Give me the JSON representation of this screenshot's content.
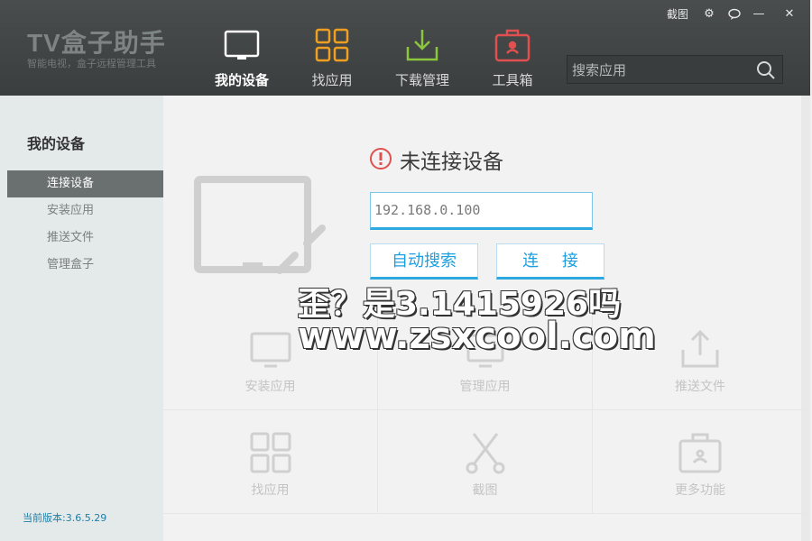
{
  "app": {
    "title": "TV盒子助手",
    "subtitle": "智能电视，盒子远程管理工具"
  },
  "window_controls": {
    "capture": "截图",
    "gear": "⚙",
    "chat": "💬",
    "minimize": "—",
    "close": "✕"
  },
  "nav": {
    "items": [
      {
        "label": "我的设备",
        "icon": "tv-icon",
        "active": true
      },
      {
        "label": "找应用",
        "icon": "apps-grid-icon",
        "active": false
      },
      {
        "label": "下载管理",
        "icon": "download-icon",
        "active": false
      },
      {
        "label": "工具箱",
        "icon": "toolbox-icon",
        "active": false
      }
    ]
  },
  "search": {
    "placeholder": "搜索应用"
  },
  "sidebar": {
    "title": "我的设备",
    "items": [
      {
        "label": "连接设备",
        "active": true
      },
      {
        "label": "安装应用",
        "active": false
      },
      {
        "label": "推送文件",
        "active": false
      },
      {
        "label": "管理盒子",
        "active": false
      }
    ],
    "version": "当前版本:3.6.5.29"
  },
  "connect": {
    "status": "未连接设备",
    "ip_value": "192.168.0.100",
    "auto_search_label": "自动搜索",
    "connect_label": "连 接"
  },
  "features": [
    {
      "label": "安装应用",
      "icon": "tv-icon"
    },
    {
      "label": "管理应用",
      "icon": "manage-icon"
    },
    {
      "label": "推送文件",
      "icon": "push-file-icon"
    },
    {
      "label": "找应用",
      "icon": "apps-grid-icon"
    },
    {
      "label": "截图",
      "icon": "scissors-icon"
    },
    {
      "label": "更多功能",
      "icon": "toolbox-icon"
    }
  ],
  "watermark": {
    "line1": "歪？是3.1415926吗",
    "line2": "www.zsxcool.com"
  },
  "colors": {
    "accent": "#2ea8e0",
    "nav_icon_orange": "#f0a020",
    "nav_icon_green": "#8cc63f",
    "nav_icon_red": "#e05050",
    "status_red": "#e05050"
  }
}
